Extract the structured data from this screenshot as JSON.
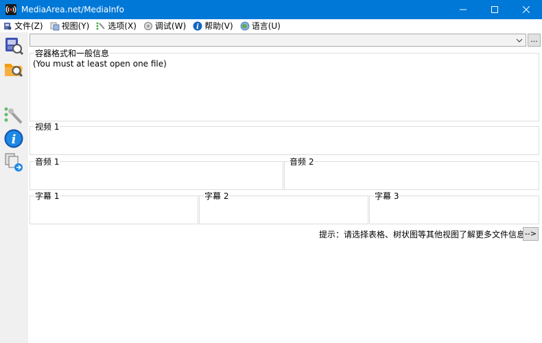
{
  "window": {
    "title": "MediaArea.net/MediaInfo",
    "accent_color": "#0078d7"
  },
  "window_controls": {
    "minimize_icon": "minimize-icon",
    "maximize_icon": "maximize-icon",
    "close_icon": "close-icon"
  },
  "menu": {
    "items": [
      {
        "label": "文件(Z)",
        "icon": "file-icon"
      },
      {
        "label": "视图(Y)",
        "icon": "view-icon"
      },
      {
        "label": "选项(X)",
        "icon": "options-icon"
      },
      {
        "label": "调试(W)",
        "icon": "debug-icon"
      },
      {
        "label": "帮助(V)",
        "icon": "help-icon"
      },
      {
        "label": "语言(U)",
        "icon": "language-icon"
      }
    ]
  },
  "toolbar": {
    "buttons": [
      {
        "icon": "open-file-icon"
      },
      {
        "icon": "open-folder-icon"
      },
      {
        "icon": "preferences-icon"
      },
      {
        "icon": "about-icon"
      },
      {
        "icon": "export-icon"
      }
    ]
  },
  "file_selector": {
    "value": "",
    "browse_label": "..."
  },
  "general": {
    "label": "容器格式和一般信息",
    "message": "(You must at least open one file)"
  },
  "video": {
    "label": "视频 1"
  },
  "audio": {
    "labels": [
      "音频 1",
      "音频 2"
    ]
  },
  "subtitles": {
    "labels": [
      "字幕 1",
      "字幕 2",
      "字幕 3"
    ]
  },
  "hint": {
    "text": "提示：请选择表格、树状图等其他视图了解更多文件信息",
    "button_label": "-->"
  }
}
